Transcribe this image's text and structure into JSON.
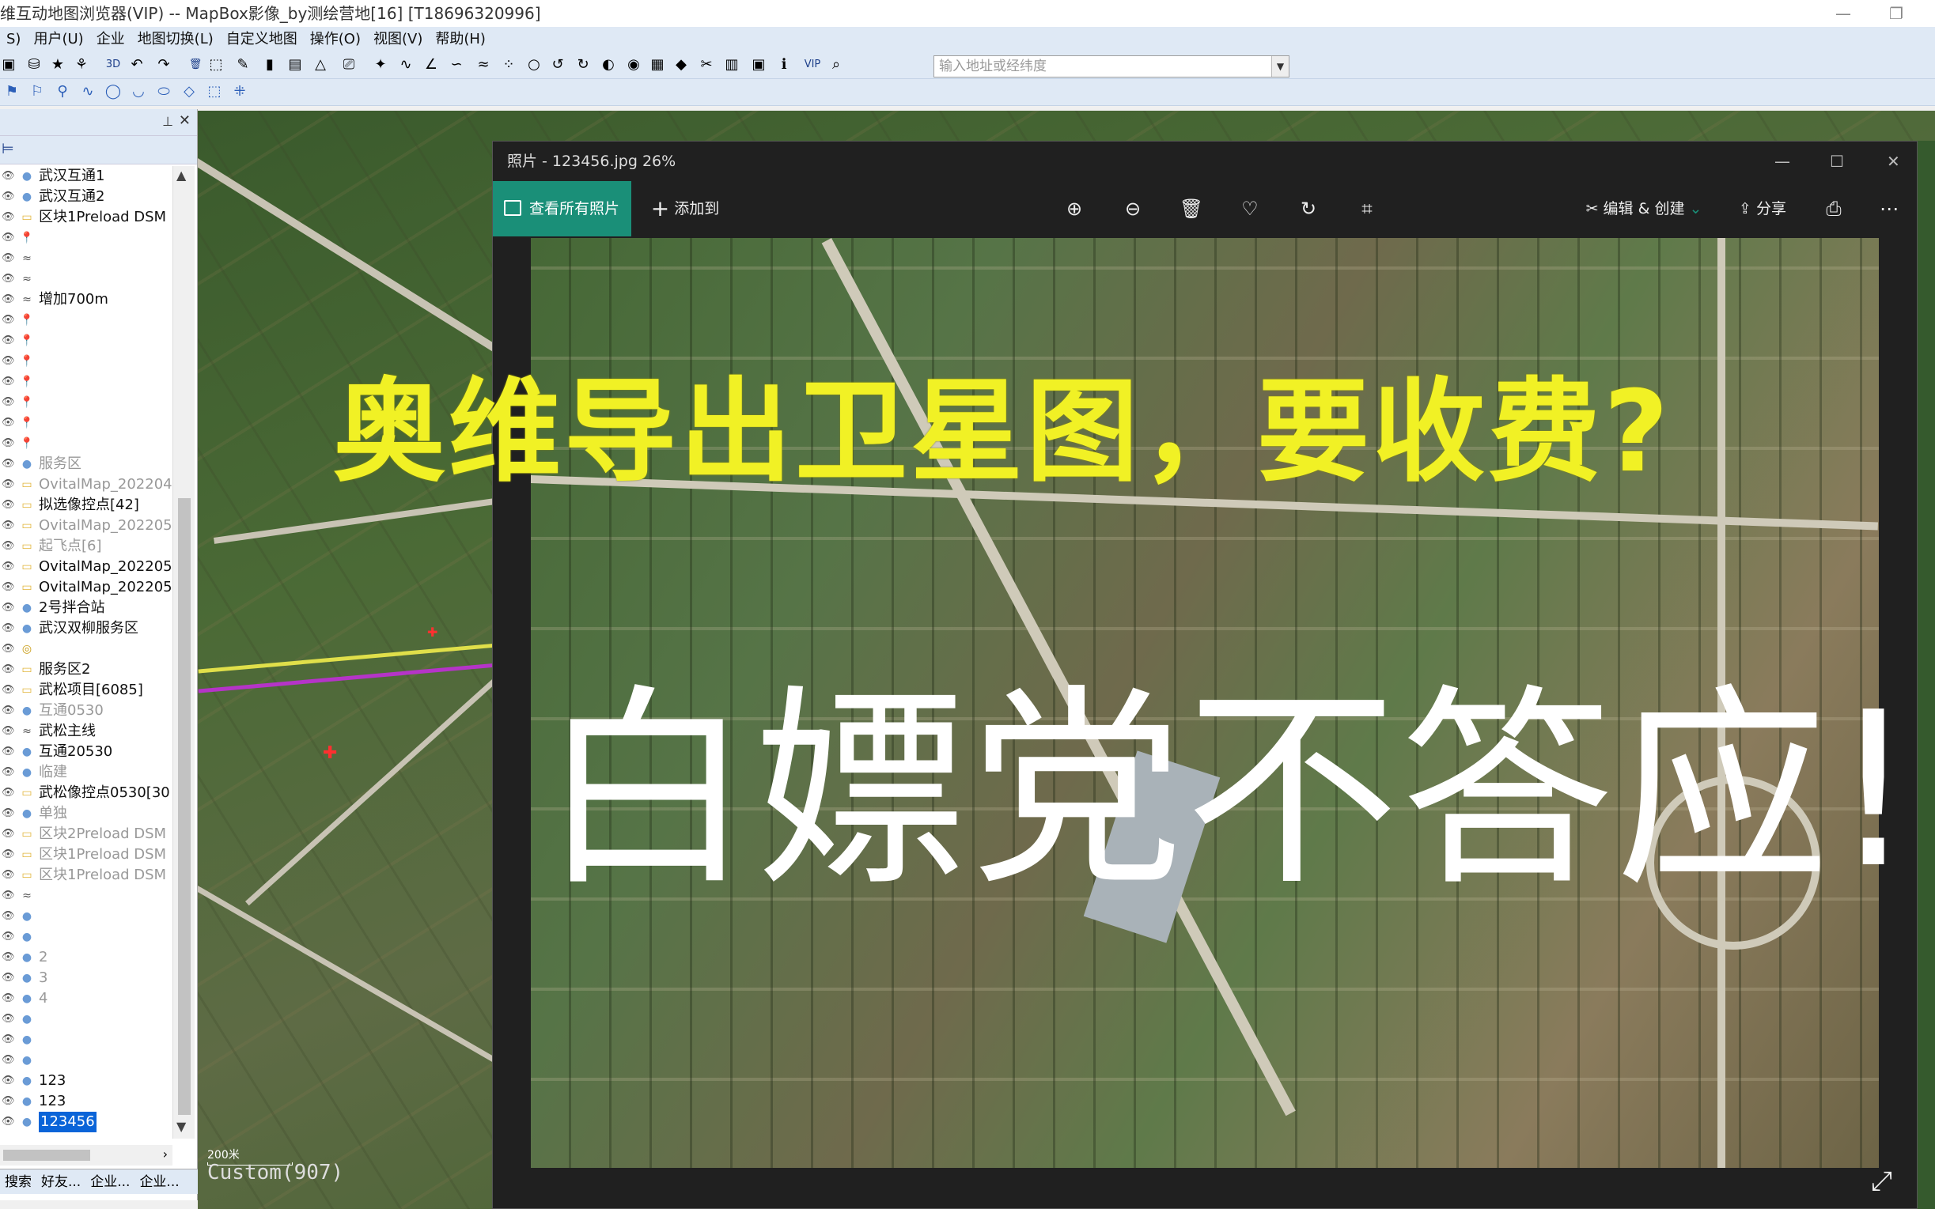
{
  "window": {
    "title": "维互动地图浏览器(VIP) -- MapBox影像_by测绘营地[16] [T18696320996]"
  },
  "menu": [
    "S)",
    "用户(U)",
    "企业",
    "地图切换(L)",
    "自定义地图",
    "操作(O)",
    "视图(V)",
    "帮助(H)"
  ],
  "toolbar": {
    "search_placeholder": "输入地址或经纬度",
    "label_3d": "3D",
    "label_vip": "VIP"
  },
  "layers": [
    {
      "label": "武汉互通1",
      "type": "dot",
      "dim": false
    },
    {
      "label": "武汉互通2",
      "type": "dot",
      "dim": false
    },
    {
      "label": "区块1Preload DSM",
      "type": "folder",
      "dim": false
    },
    {
      "label": "",
      "type": "pin",
      "dim": false
    },
    {
      "label": "",
      "type": "route",
      "dim": false
    },
    {
      "label": "",
      "type": "route",
      "dim": false
    },
    {
      "label": "增加700m",
      "type": "route",
      "dim": false
    },
    {
      "label": "",
      "type": "pin",
      "dim": false
    },
    {
      "label": "",
      "type": "pin",
      "dim": false
    },
    {
      "label": "",
      "type": "pin",
      "dim": false
    },
    {
      "label": "",
      "type": "pin",
      "dim": false
    },
    {
      "label": "",
      "type": "pin",
      "dim": false
    },
    {
      "label": "",
      "type": "pin",
      "dim": false
    },
    {
      "label": "",
      "type": "pin",
      "dim": false
    },
    {
      "label": "服务区",
      "type": "dot",
      "dim": true
    },
    {
      "label": "OvitalMap_202204",
      "type": "folder",
      "dim": true
    },
    {
      "label": "拟选像控点[42]",
      "type": "folder",
      "dim": false
    },
    {
      "label": "OvitalMap_202205",
      "type": "folder",
      "dim": true
    },
    {
      "label": "起飞点[6]",
      "type": "folder",
      "dim": true
    },
    {
      "label": "OvitalMap_202205",
      "type": "folder",
      "dim": false
    },
    {
      "label": "OvitalMap_202205",
      "type": "folder",
      "dim": false
    },
    {
      "label": "2号拌合站",
      "type": "dot",
      "dim": false
    },
    {
      "label": "武汉双柳服务区",
      "type": "dot",
      "dim": false
    },
    {
      "label": "",
      "type": "target",
      "dim": false
    },
    {
      "label": "服务区2",
      "type": "folder",
      "dim": false
    },
    {
      "label": "武松项目[6085]",
      "type": "folder",
      "dim": false
    },
    {
      "label": "互通0530",
      "type": "dot",
      "dim": true
    },
    {
      "label": "武松主线",
      "type": "route",
      "dim": false
    },
    {
      "label": "互通20530",
      "type": "dot",
      "dim": false
    },
    {
      "label": "临建",
      "type": "dot",
      "dim": true
    },
    {
      "label": "武松像控点0530[30",
      "type": "folder",
      "dim": false
    },
    {
      "label": "单独",
      "type": "dot",
      "dim": true
    },
    {
      "label": "区块2Preload DSM",
      "type": "folder",
      "dim": true
    },
    {
      "label": "区块1Preload DSM",
      "type": "folder",
      "dim": true
    },
    {
      "label": "区块1Preload DSM",
      "type": "folder",
      "dim": true
    },
    {
      "label": "",
      "type": "route",
      "dim": false
    },
    {
      "label": "",
      "type": "dot",
      "dim": true
    },
    {
      "label": "",
      "type": "dot",
      "dim": true
    },
    {
      "label": "2",
      "type": "dot",
      "dim": true
    },
    {
      "label": "3",
      "type": "dot",
      "dim": true
    },
    {
      "label": "4",
      "type": "dot",
      "dim": true
    },
    {
      "label": "",
      "type": "dot",
      "dim": false
    },
    {
      "label": "",
      "type": "dot",
      "dim": true
    },
    {
      "label": "",
      "type": "dot",
      "dim": false
    },
    {
      "label": "123",
      "type": "dot",
      "dim": false
    },
    {
      "label": "123",
      "type": "dot",
      "dim": false
    },
    {
      "label": "123456",
      "type": "dot",
      "dim": false,
      "selected": true
    }
  ],
  "bottom_tabs": [
    "搜索",
    "好友...",
    "企业...",
    "企业..."
  ],
  "map": {
    "scale_label": "200米",
    "custom_label": "Custom(907)"
  },
  "photos": {
    "title": "照片 - 123456.jpg   26%",
    "view_all": "查看所有照片",
    "add_to": "添加到",
    "edit_create": "编辑 & 创建",
    "share": "分享",
    "headline1": "奥维导出卫星图，要收费?",
    "headline2": "白嫖党不答应!"
  },
  "colors": {
    "accent": "#1a8f78",
    "headline_yellow": "#f1f125",
    "selection": "#0a64d8"
  }
}
